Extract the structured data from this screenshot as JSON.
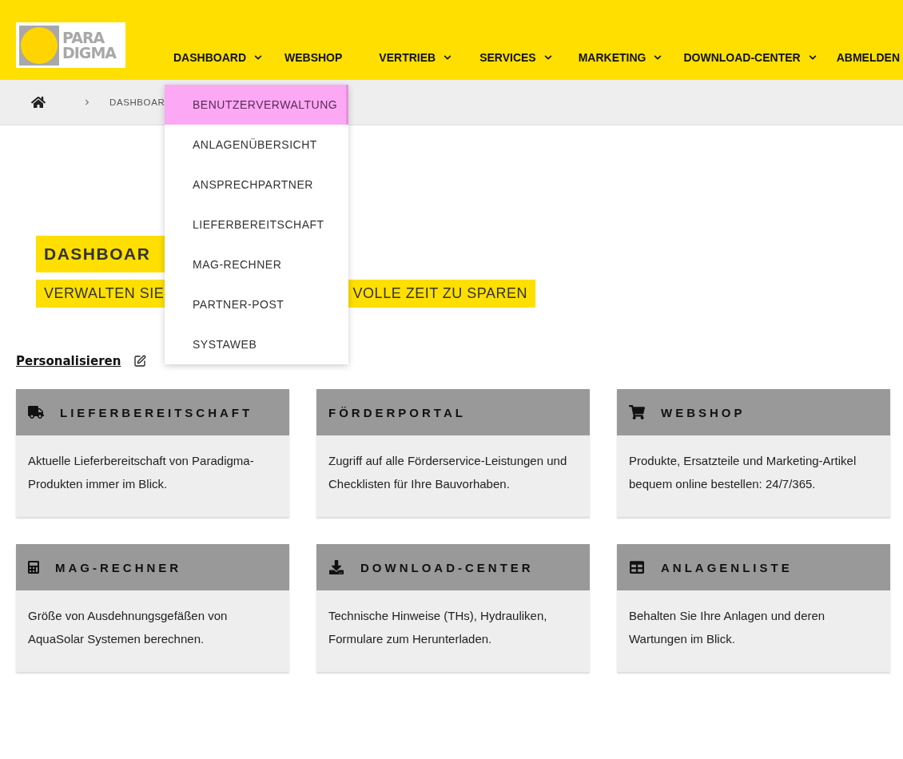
{
  "logo": {
    "line_1": "PARA",
    "line_2": "DIGMA"
  },
  "nav": [
    {
      "label": "DASHBOARD",
      "has_caret": true
    },
    {
      "label": "WEBSHOP",
      "has_caret": false
    },
    {
      "label": "VERTRIEB",
      "has_caret": true
    },
    {
      "label": "SERVICES",
      "has_caret": true
    },
    {
      "label": "MARKETING",
      "has_caret": true
    },
    {
      "label": "DOWNLOAD-CENTER",
      "has_caret": true
    },
    {
      "label": "ABMELDEN",
      "has_caret": false
    }
  ],
  "breadcrumb": {
    "current": "DASHBOAR"
  },
  "dropdown": [
    {
      "label": "BENUTZERVERWALTUNG",
      "selected": true
    },
    {
      "label": "ANLAGENÜBERSICHT",
      "selected": false
    },
    {
      "label": "ANSPRECHPARTNER",
      "selected": false
    },
    {
      "label": "LIEFERBEREITSCHAFT",
      "selected": false
    },
    {
      "label": "MAG-RECHNER",
      "selected": false
    },
    {
      "label": "PARTNER-POST",
      "selected": false
    },
    {
      "label": "SYSTAWEB",
      "selected": false
    }
  ],
  "hero": {
    "title": "DASHBOAR",
    "subtitle_left": "VERWALTEN SIE",
    "subtitle_right": "VOLLE ZEIT ZU SPAREN"
  },
  "personalize": "Personalisieren",
  "cards": [
    {
      "kind": "truck",
      "title": "LIEFERBEREITSCHAFT",
      "text": "Aktuelle Lieferbereitschaft von Paradigma-Produkten immer im Blick."
    },
    {
      "kind": "plain",
      "title": "FÖRDERPORTAL",
      "text": "Zugriff auf alle Förderservice-Leistungen und Checklisten für Ihre Bauvorhaben."
    },
    {
      "kind": "cart",
      "title": "WEBSHOP",
      "text": "Produkte, Ersatzteile und Marketing-Artikel bequem online bestellen: 24/7/365."
    },
    {
      "kind": "calculator",
      "title": "MAG-RECHNER",
      "text": "Größe von Ausdehnungsgefäßen von AquaSolar Systemen berechnen."
    },
    {
      "kind": "download",
      "title": "DOWNLOAD-CENTER",
      "text": "Technische Hinweise (THs), Hydrauliken, Formulare zum Herunterladen."
    },
    {
      "kind": "table",
      "title": "ANLAGENLISTE",
      "text": "Behalten Sie Ihre Anlagen und deren Wartungen im Blick."
    }
  ]
}
